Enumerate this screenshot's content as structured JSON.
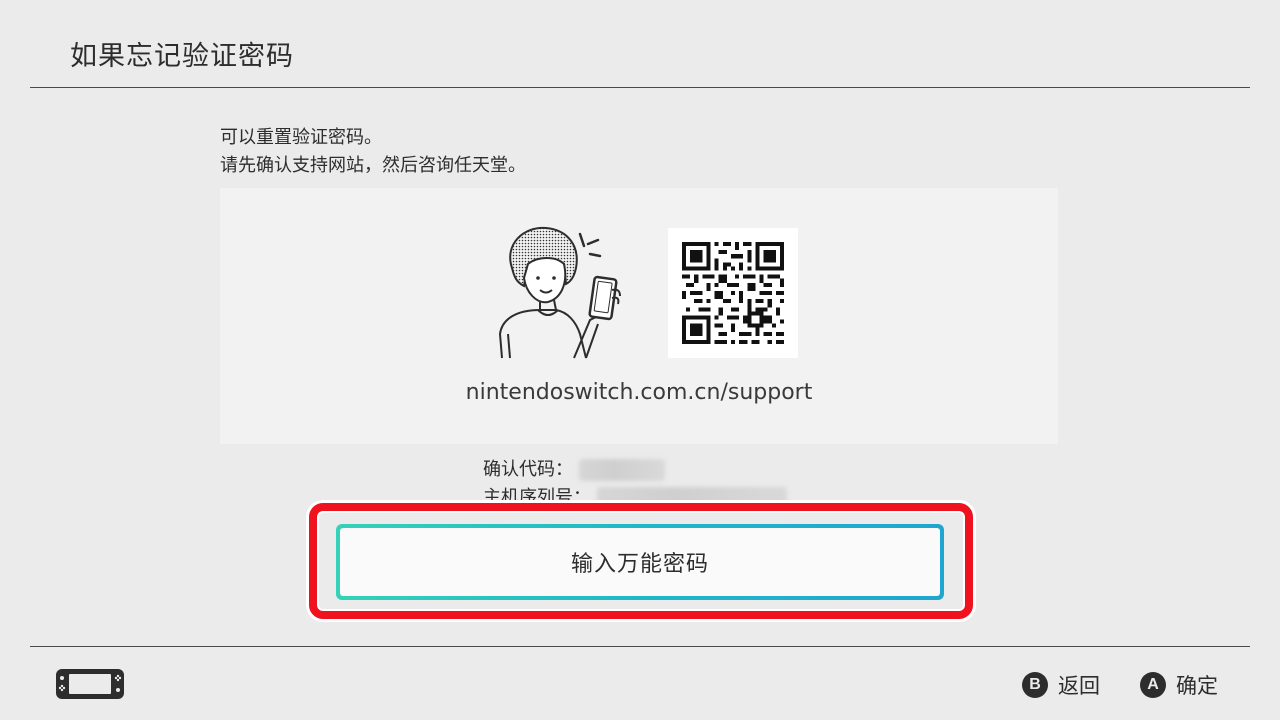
{
  "header": {
    "title": "如果忘记验证密码"
  },
  "description": {
    "line1": "可以重置验证密码。",
    "line2": "请先确认支持网站，然后咨询任天堂。"
  },
  "support": {
    "url": "nintendoswitch.com.cn/support",
    "illustration_icon": "person-with-phone-illustration",
    "qr_icon": "qr-code"
  },
  "codes": {
    "confirmation_label": "确认代码：",
    "serial_label": "主机序列号："
  },
  "master_key_button": {
    "label": "输入万能密码"
  },
  "footer": {
    "device_icon": "switch-console-icon",
    "back": {
      "button": "B",
      "label": "返回"
    },
    "ok": {
      "button": "A",
      "label": "确定"
    }
  },
  "colors": {
    "background": "#ebebeb",
    "panel": "#f2f2f2",
    "highlight": "#f0131f",
    "button_border_start": "#35d1b8",
    "button_border_end": "#1fa6d0"
  }
}
